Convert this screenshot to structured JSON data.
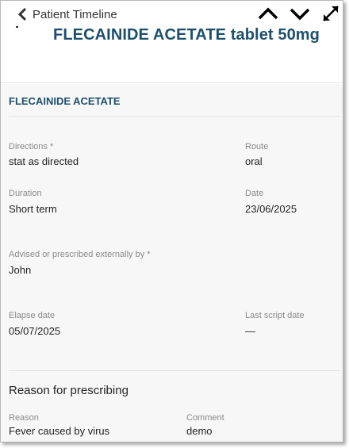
{
  "header": {
    "back_label": "Patient Timeline",
    "title": "FLECAINIDE ACETATE tablet 50mg",
    "icons": [
      "chevron-up-icon",
      "chevron-down-icon",
      "expand-icon"
    ]
  },
  "section": {
    "title": "FLECAINIDE ACETATE"
  },
  "fields": {
    "directions": {
      "label": "Directions *",
      "value": "stat as directed"
    },
    "route": {
      "label": "Route",
      "value": "oral"
    },
    "duration": {
      "label": "Duration",
      "value": "Short term"
    },
    "date": {
      "label": "Date",
      "value": "23/06/2025"
    },
    "advised": {
      "label": "Advised or prescribed externally by *",
      "value": "John"
    },
    "elapse": {
      "label": "Elapse date",
      "value": "05/07/2025"
    },
    "last_script": {
      "label": "Last script date",
      "value": "—"
    }
  },
  "reason_section": {
    "title": "Reason for prescribing",
    "reason": {
      "label": "Reason",
      "value": "Fever caused by virus"
    },
    "comment": {
      "label": "Comment",
      "value": "demo"
    }
  },
  "colors": {
    "accent": "#1c4f6e",
    "label": "#8a8a8a",
    "body_bg": "#f7f7f7"
  }
}
